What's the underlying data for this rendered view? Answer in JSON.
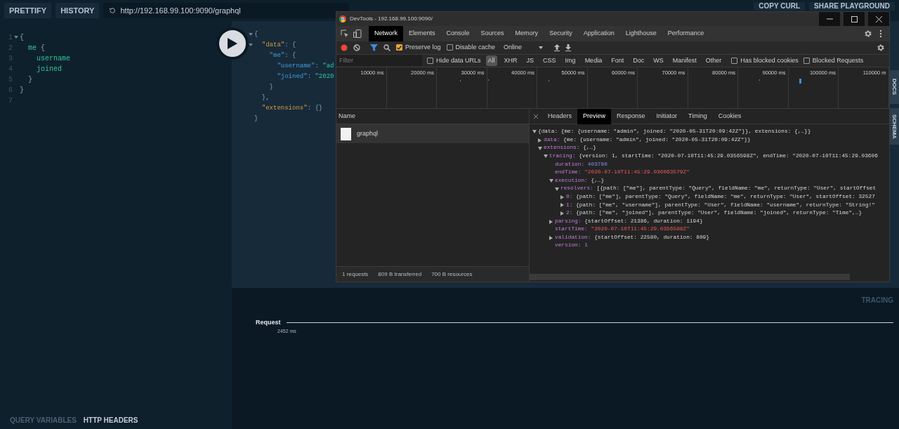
{
  "toolbar": {
    "buttons": [
      "PRETTIFY",
      "HISTORY"
    ],
    "url": "http://192.168.99.100:9090/graphql",
    "right_buttons": [
      "COPY CURL",
      "SHARE PLAYGROUND"
    ]
  },
  "editor": {
    "lines": [
      {
        "number": "1",
        "foldable": true,
        "tokens": [
          {
            "text": "{",
            "kind": "punct"
          }
        ]
      },
      {
        "number": "2",
        "foldable": false,
        "tokens": [
          {
            "text": "  me",
            "kind": "field"
          },
          {
            "text": " {",
            "kind": "punct"
          }
        ]
      },
      {
        "number": "3",
        "foldable": false,
        "tokens": [
          {
            "text": "    username",
            "kind": "field"
          }
        ]
      },
      {
        "number": "4",
        "foldable": false,
        "tokens": [
          {
            "text": "    joined",
            "kind": "field"
          }
        ]
      },
      {
        "number": "5",
        "foldable": false,
        "tokens": [
          {
            "text": "  }",
            "kind": "punct"
          }
        ]
      },
      {
        "number": "6",
        "foldable": false,
        "tokens": [
          {
            "text": "}",
            "kind": "punct"
          }
        ]
      },
      {
        "number": "7",
        "foldable": false
      }
    ]
  },
  "result": {
    "lines": [
      {
        "foldable": true,
        "tokens": [
          {
            "text": "{",
            "kind": "punct"
          }
        ]
      },
      {
        "foldable": true,
        "tokens": [
          {
            "text": "  \"data\"",
            "kind": "key"
          },
          {
            "text": ": {",
            "kind": "punct"
          }
        ]
      },
      {
        "foldable": false,
        "tokens": [
          {
            "text": "    \"me\"",
            "kind": "field"
          },
          {
            "text": ": {",
            "kind": "punct"
          }
        ]
      },
      {
        "foldable": false,
        "tokens": [
          {
            "text": "      \"username\"",
            "kind": "field"
          },
          {
            "text": ": ",
            "kind": "punct"
          },
          {
            "text": "\"ad",
            "kind": "string"
          }
        ]
      },
      {
        "foldable": false,
        "tokens": [
          {
            "text": "      \"joined\"",
            "kind": "field"
          },
          {
            "text": ": ",
            "kind": "punct"
          },
          {
            "text": "\"2020",
            "kind": "string"
          }
        ]
      },
      {
        "foldable": false,
        "tokens": [
          {
            "text": "    }",
            "kind": "punct"
          }
        ]
      },
      {
        "foldable": false,
        "tokens": [
          {
            "text": "  },",
            "kind": "punct"
          }
        ]
      },
      {
        "foldable": false,
        "tokens": [
          {
            "text": "  \"extensions\"",
            "kind": "key"
          },
          {
            "text": ": {}",
            "kind": "punct"
          }
        ]
      },
      {
        "foldable": false,
        "tokens": [
          {
            "text": "}",
            "kind": "punct"
          }
        ]
      }
    ]
  },
  "side_tabs": [
    "DOCS",
    "SCHEMA"
  ],
  "tracing": {
    "title": "TRACING",
    "label": "Request",
    "duration": "2452 ms"
  },
  "bottom_tabs": [
    {
      "label": "QUERY VARIABLES",
      "selected": false
    },
    {
      "label": "HTTP HEADERS",
      "selected": true
    }
  ],
  "devtools": {
    "title": "DevTools - 192.168.99.100:9090/",
    "tabs": [
      {
        "label": "Network",
        "selected": true
      },
      {
        "label": "Elements",
        "selected": false
      },
      {
        "label": "Console",
        "selected": false
      },
      {
        "label": "Sources",
        "selected": false
      },
      {
        "label": "Memory",
        "selected": false
      },
      {
        "label": "Security",
        "selected": false
      },
      {
        "label": "Application",
        "selected": false
      },
      {
        "label": "Lighthouse",
        "selected": false
      },
      {
        "label": "Performance",
        "selected": false
      }
    ],
    "recording": true,
    "filter_active": true,
    "preserve_log": {
      "label": "Preserve log",
      "checked": true
    },
    "disable_cache": {
      "label": "Disable cache",
      "checked": false
    },
    "throttle": "Online",
    "filter": {
      "placeholder": "Filter",
      "hide_data_urls": {
        "label": "Hide data URLs",
        "checked": false
      },
      "types": [
        {
          "label": "All",
          "selected": true
        },
        {
          "label": "XHR",
          "selected": false
        },
        {
          "label": "JS",
          "selected": false
        },
        {
          "label": "CSS",
          "selected": false
        },
        {
          "label": "Img",
          "selected": false
        },
        {
          "label": "Media",
          "selected": false
        },
        {
          "label": "Font",
          "selected": false
        },
        {
          "label": "Doc",
          "selected": false
        },
        {
          "label": "WS",
          "selected": false
        },
        {
          "label": "Manifest",
          "selected": false
        },
        {
          "label": "Other",
          "selected": false
        }
      ],
      "has_blocked_cookies": {
        "label": "Has blocked cookies",
        "checked": false
      },
      "blocked_requests": {
        "label": "Blocked Requests",
        "checked": false
      }
    },
    "timeline": {
      "ticks": [
        "10000 ms",
        "20000 ms",
        "30000 ms",
        "40000 ms",
        "50000 ms",
        "60000 ms",
        "70000 ms",
        "80000 ms",
        "90000 ms",
        "100000 ms",
        "110000 m"
      ]
    },
    "requests": {
      "header": "Name",
      "rows": [
        {
          "name": "graphql",
          "selected": true
        }
      ]
    },
    "summary": [
      "1 requests",
      "809 B transferred",
      "700 B resources"
    ],
    "detail_tabs": [
      {
        "label": "Headers",
        "selected": false
      },
      {
        "label": "Preview",
        "selected": true
      },
      {
        "label": "Response",
        "selected": false
      },
      {
        "label": "Initiator",
        "selected": false
      },
      {
        "label": "Timing",
        "selected": false
      },
      {
        "label": "Cookies",
        "selected": false
      }
    ],
    "preview": [
      {
        "value": "{data: {me: {username: \"admin\", joined: \"2020-05-31T20:09:42Z\"}}, extensions: {,…}}",
        "kind": "object",
        "expanded": true,
        "children": [
          {
            "key": "data:",
            "value": "{me: {username: \"admin\", joined: \"2020-05-31T20:09:42Z\"}}",
            "kind": "object",
            "expanded": false
          },
          {
            "key": "extensions:",
            "value": "{,…}",
            "kind": "object",
            "expanded": true,
            "children": [
              {
                "key": "tracing:",
                "value": "{version: 1, startTime: \"2020-07-10T11:45:29.0356598Z\", endTime: \"2020-07-10T11:45:29.03606",
                "kind": "object",
                "expanded": true,
                "children": [
                  {
                    "key": "duration:",
                    "value": "403780",
                    "kind": "number"
                  },
                  {
                    "key": "endTime:",
                    "value": "\"2020-07-10T11:45:29.036063579Z\"",
                    "kind": "string"
                  },
                  {
                    "key": "execution:",
                    "value": "{,…}",
                    "kind": "object",
                    "expanded": true,
                    "children": [
                      {
                        "key": "resolvers:",
                        "value": "[{path: [\"me\"], parentType: \"Query\", fieldName: \"me\", returnType: \"User\", startOffset",
                        "kind": "object",
                        "expanded": true,
                        "children": [
                          {
                            "key": "0:",
                            "value": "{path: [\"me\"], parentType: \"Query\", fieldName: \"me\", returnType: \"User\", startOffset: 32527",
                            "kind": "object",
                            "expanded": false
                          },
                          {
                            "key": "1:",
                            "value": "{path: [\"me\", \"username\"], parentType: \"User\", fieldName: \"username\", returnType: \"String!\"",
                            "kind": "object",
                            "expanded": false
                          },
                          {
                            "key": "2:",
                            "value": "{path: [\"me\", \"joined\"], parentType: \"User\", fieldName: \"joined\", returnType: \"Time\",…}",
                            "kind": "object",
                            "expanded": false
                          }
                        ]
                      }
                    ]
                  },
                  {
                    "key": "parsing:",
                    "value": "{startOffset: 21386, duration: 1194}",
                    "kind": "object",
                    "expanded": false
                  },
                  {
                    "key": "startTime:",
                    "value": "\"2020-07-10T11:45:29.0356598Z\"",
                    "kind": "string"
                  },
                  {
                    "key": "validation:",
                    "value": "{startOffset: 22580, duration: 809}",
                    "kind": "object",
                    "expanded": false
                  },
                  {
                    "key": "version:",
                    "value": "1",
                    "kind": "number"
                  }
                ]
              }
            ]
          }
        ]
      }
    ]
  }
}
